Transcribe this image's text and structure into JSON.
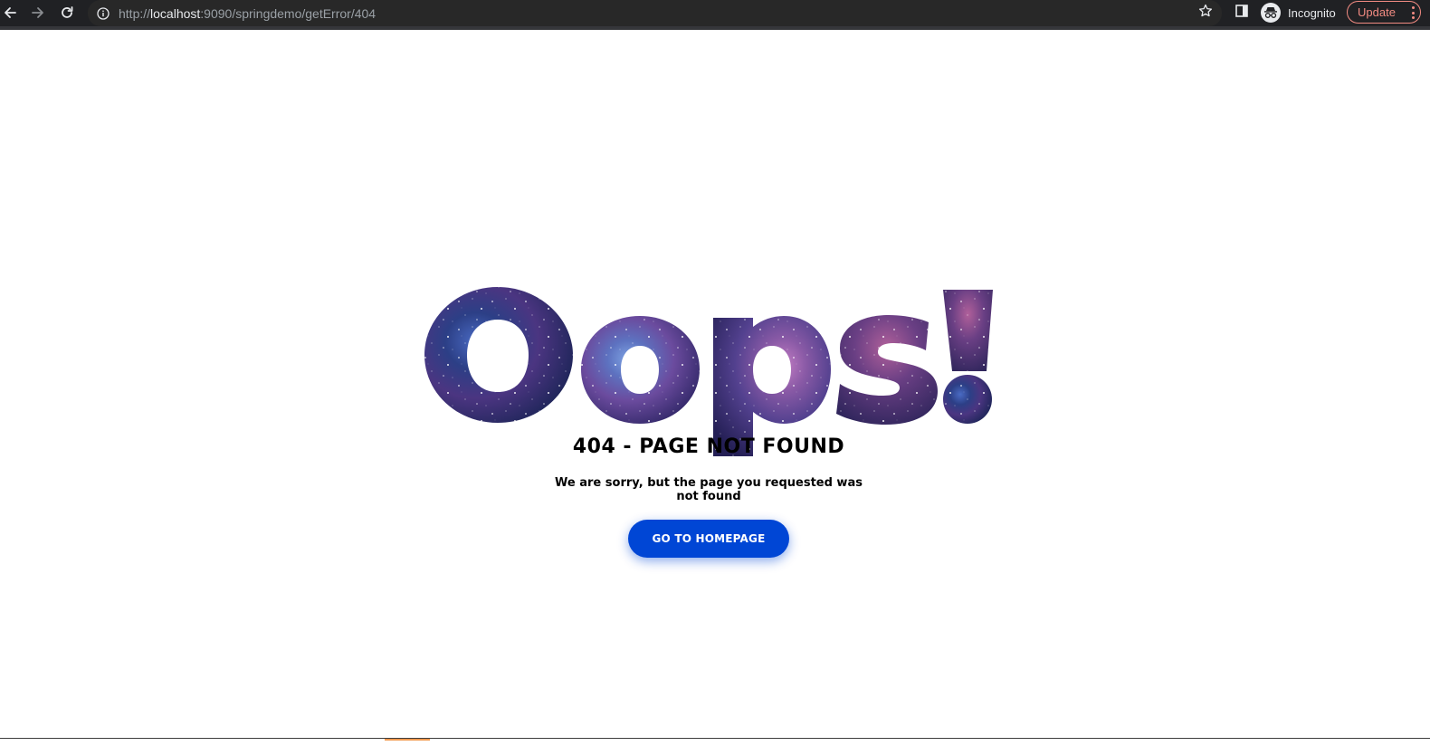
{
  "browser": {
    "url_scheme": "http://",
    "url_host": "localhost",
    "url_rest": ":9090/springdemo/getError/404",
    "profile_label": "Incognito",
    "update_label": "Update",
    "icons": {
      "back": "arrow-left-icon",
      "forward": "arrow-right-icon",
      "reload": "reload-icon",
      "site_info": "info-icon",
      "bookmark": "star-icon",
      "side_panel": "side-panel-icon",
      "incognito": "incognito-icon",
      "menu": "more-vert-icon"
    },
    "colors": {
      "chrome_bg": "#202124",
      "omnibox_bg": "#282828",
      "update_accent": "#f28b82"
    }
  },
  "error_page": {
    "hero_text": "Oops!",
    "title": "404 - PAGE NOT FOUND",
    "message": "We are sorry, but the page you requested was not found",
    "button_label": "GO TO HOMEPAGE",
    "colors": {
      "button": "#0046d5",
      "text": "#000000",
      "galaxy_deep": "#1c2f6a",
      "galaxy_violet": "#5a3d8c",
      "galaxy_pink": "#a35a9e"
    }
  }
}
